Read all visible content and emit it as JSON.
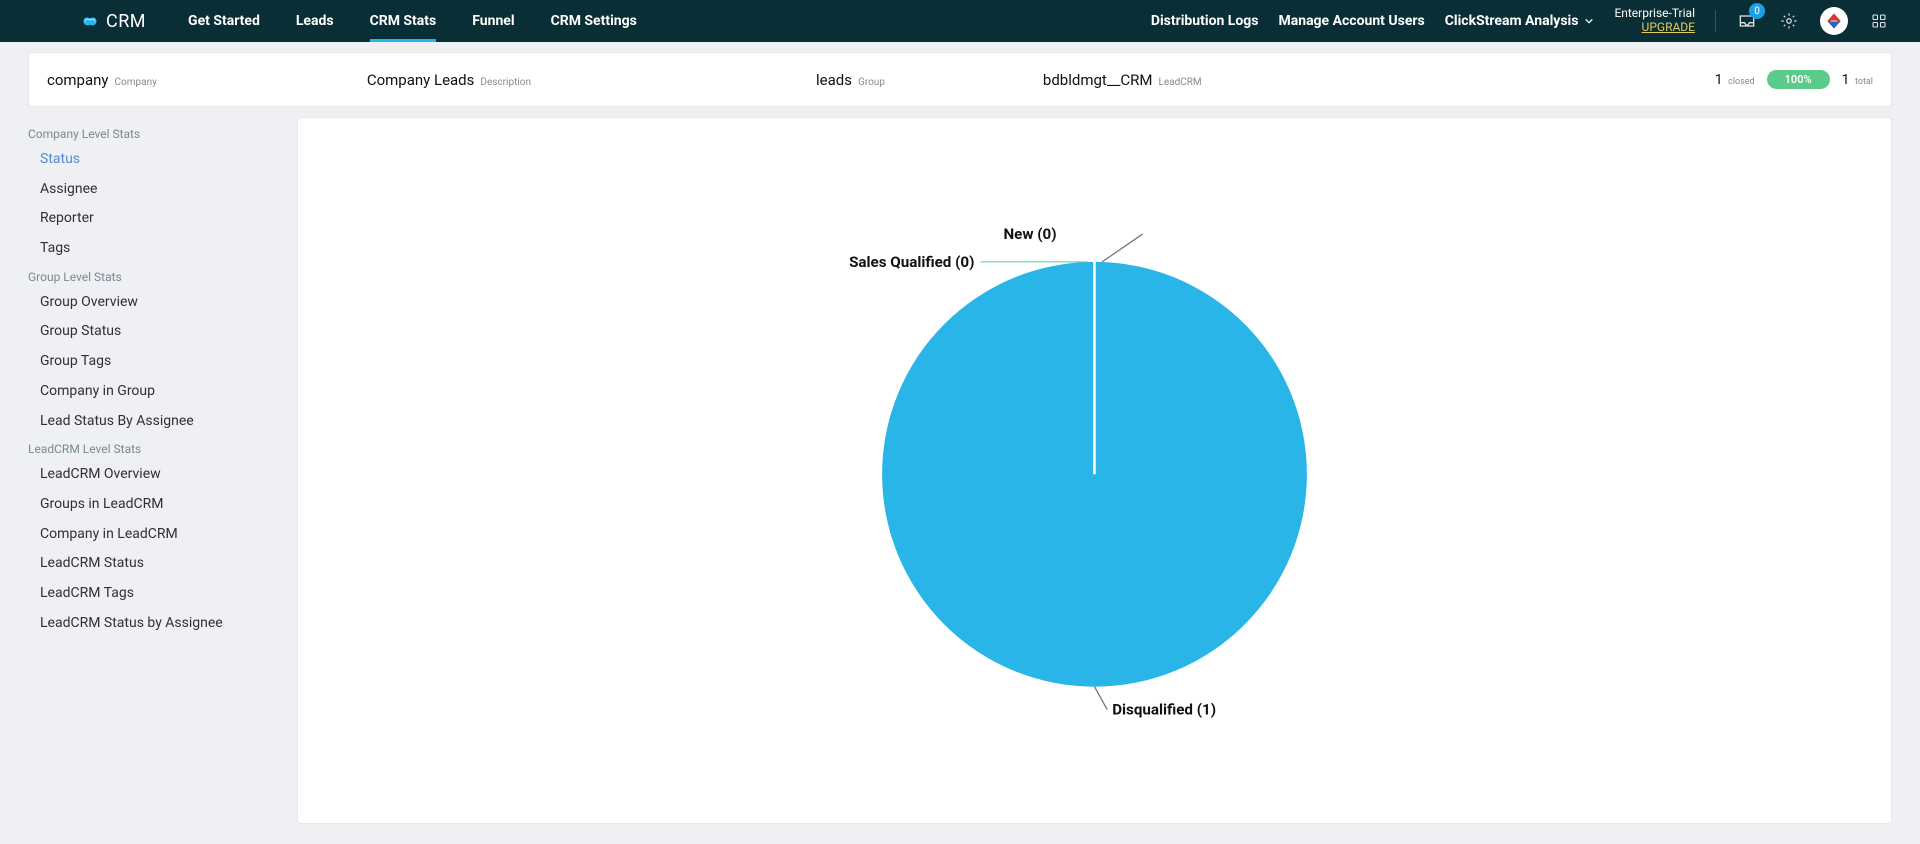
{
  "nav": {
    "brand": "CRM",
    "tabs": [
      {
        "label": "Get Started",
        "active": false
      },
      {
        "label": "Leads",
        "active": false
      },
      {
        "label": "CRM Stats",
        "active": true
      },
      {
        "label": "Funnel",
        "active": false
      },
      {
        "label": "CRM Settings",
        "active": false
      }
    ],
    "right_links": [
      {
        "label": "Distribution Logs"
      },
      {
        "label": "Manage Account Users"
      },
      {
        "label": "ClickStream Analysis",
        "has_chevron": true
      }
    ],
    "tier": "Enterprise-Trial",
    "upgrade": "UPGRADE",
    "notification_count": "0"
  },
  "infobar": {
    "company_value": "company",
    "company_label": "Company",
    "leads_value": "Company Leads",
    "leads_label": "Description",
    "group_value": "leads",
    "group_label": "Group",
    "crm_value": "bdbldmgt__CRM",
    "crm_label": "LeadCRM",
    "closed_count": "1",
    "closed_label": "closed",
    "progress_pct": "100%",
    "total_count": "1",
    "total_label": "total"
  },
  "sidebar": {
    "sections": [
      {
        "title": "Company Level Stats",
        "items": [
          {
            "label": "Status",
            "active": true
          },
          {
            "label": "Assignee"
          },
          {
            "label": "Reporter"
          },
          {
            "label": "Tags"
          }
        ]
      },
      {
        "title": "Group Level Stats",
        "items": [
          {
            "label": "Group Overview"
          },
          {
            "label": "Group Status"
          },
          {
            "label": "Group Tags"
          },
          {
            "label": "Company in Group"
          },
          {
            "label": "Lead Status By Assignee"
          }
        ]
      },
      {
        "title": "LeadCRM Level Stats",
        "items": [
          {
            "label": "LeadCRM Overview"
          },
          {
            "label": "Groups in LeadCRM"
          },
          {
            "label": "Company in LeadCRM"
          },
          {
            "label": "LeadCRM Status"
          },
          {
            "label": "LeadCRM Tags"
          },
          {
            "label": "LeadCRM Status by Assignee"
          }
        ]
      }
    ]
  },
  "chart_data": {
    "type": "pie",
    "title": "",
    "series": [
      {
        "name": "New",
        "value": 0,
        "label": "New (0)",
        "color": "#29b5e8"
      },
      {
        "name": "Sales Qualified",
        "value": 0,
        "label": "Sales Qualified (0)",
        "color": "#6fd6b4"
      },
      {
        "name": "Disqualified",
        "value": 1,
        "label": "Disqualified (1)",
        "color": "#29b5e8"
      }
    ]
  }
}
